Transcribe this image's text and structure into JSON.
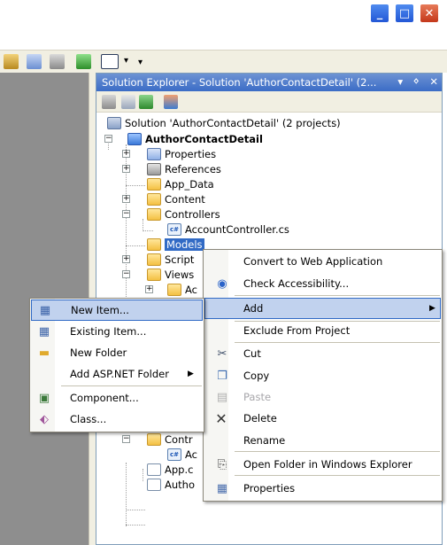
{
  "window": {
    "minimize_glyph": "_",
    "maximize_glyph": "□",
    "close_glyph": "✕",
    "close_color": "#c4371a",
    "accent": "#2257d6"
  },
  "toolbar": {
    "icons": [
      "settings-icon",
      "mail-icon",
      "tools-icon",
      "export-icon",
      "window-icon",
      "dropdown-icon"
    ]
  },
  "solution_explorer": {
    "title": "Solution Explorer - Solution 'AuthorContactDetail' (2...",
    "pin_glyph": "▾",
    "autohide_glyph": "ᛜ",
    "close_glyph": "✕",
    "tree": {
      "solution": "Solution 'AuthorContactDetail' (2 projects)",
      "project": "AuthorContactDetail",
      "properties": "Properties",
      "references": "References",
      "app_data": "App_Data",
      "content": "Content",
      "controllers": "Controllers",
      "account_controller": "AccountController.cs",
      "models": "Models",
      "scripts": "Script",
      "views": "Views",
      "views_child": "Ac",
      "controllers2": "Contr",
      "controllers2_child": "Ac",
      "app_config": "App.c",
      "author_file": "Autho"
    }
  },
  "context_menu": {
    "items": {
      "convert": "Convert to Web Application",
      "check_accessibility": "Check Accessibility...",
      "add": "Add",
      "exclude": "Exclude From Project",
      "cut": "Cut",
      "copy": "Copy",
      "paste": "Paste",
      "delete": "Delete",
      "rename": "Rename",
      "open_folder": "Open Folder in Windows Explorer",
      "properties": "Properties"
    }
  },
  "add_submenu": {
    "items": {
      "new_item": "New Item...",
      "existing_item": "Existing Item...",
      "new_folder": "New Folder",
      "add_aspnet_folder": "Add ASP.NET Folder",
      "component": "Component...",
      "class": "Class..."
    },
    "highlight_color": "#c1d2ee"
  }
}
